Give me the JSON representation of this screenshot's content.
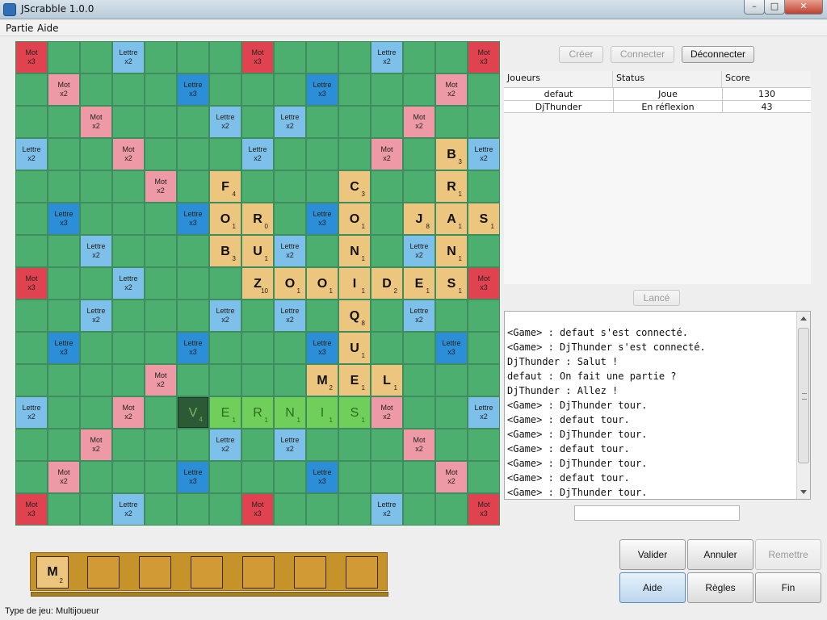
{
  "window": {
    "title": "JScrabble 1.0.0",
    "minimize": "–",
    "maximize": "□",
    "close": "✕"
  },
  "menubar": {
    "items": [
      "Partie",
      "Aide"
    ]
  },
  "board": {
    "letters": {
      "A": 1,
      "B": 3,
      "C": 3,
      "D": 2,
      "E": 1,
      "F": 4,
      "I": 1,
      "J": 8,
      "L": 1,
      "M": 2,
      "N": 1,
      "O": 1,
      "Q": 8,
      "R": 1,
      "S": 1,
      "U": 1,
      "V": 4,
      "Z": 10
    },
    "premium_labels": {
      "tw": "Mot\nx3",
      "dw": "Mot\nx2",
      "tl": "Lettre\nx3",
      "dl": "Lettre\nx2"
    },
    "layout": [
      "T..d...T...d..T",
      ".D...t...t...D.",
      "..D...d.d...D..",
      "d..D...d...D..d",
      "....D.....D....",
      ".t...t...t...t.",
      "..d...d.d...d..",
      "T..d.......d..T",
      "..d...d.d...d..",
      ".t...t...t...t.",
      "....D.....D....",
      "d..D.......D..d",
      "..D...d.d...D..",
      ".D...t...t...D.",
      "T..d...T...d..T"
    ],
    "tiles": [
      {
        "row": 3,
        "col": 13,
        "letter": "B",
        "state": "placed"
      },
      {
        "row": 4,
        "col": 6,
        "letter": "F",
        "state": "placed"
      },
      {
        "row": 4,
        "col": 10,
        "letter": "C",
        "state": "placed"
      },
      {
        "row": 4,
        "col": 13,
        "letter": "R",
        "state": "placed"
      },
      {
        "row": 5,
        "col": 6,
        "letter": "O",
        "state": "placed"
      },
      {
        "row": 5,
        "col": 7,
        "letter": "R",
        "state": "placed",
        "value": 0
      },
      {
        "row": 5,
        "col": 10,
        "letter": "O",
        "state": "placed"
      },
      {
        "row": 5,
        "col": 12,
        "letter": "J",
        "state": "placed"
      },
      {
        "row": 5,
        "col": 13,
        "letter": "A",
        "state": "placed"
      },
      {
        "row": 5,
        "col": 14,
        "letter": "S",
        "state": "placed"
      },
      {
        "row": 6,
        "col": 6,
        "letter": "B",
        "state": "placed"
      },
      {
        "row": 6,
        "col": 7,
        "letter": "U",
        "state": "placed"
      },
      {
        "row": 6,
        "col": 10,
        "letter": "N",
        "state": "placed"
      },
      {
        "row": 6,
        "col": 13,
        "letter": "N",
        "state": "placed"
      },
      {
        "row": 7,
        "col": 7,
        "letter": "Z",
        "state": "placed"
      },
      {
        "row": 7,
        "col": 8,
        "letter": "O",
        "state": "placed"
      },
      {
        "row": 7,
        "col": 9,
        "letter": "O",
        "state": "placed"
      },
      {
        "row": 7,
        "col": 10,
        "letter": "I",
        "state": "placed"
      },
      {
        "row": 7,
        "col": 11,
        "letter": "D",
        "state": "placed"
      },
      {
        "row": 7,
        "col": 12,
        "letter": "E",
        "state": "placed"
      },
      {
        "row": 7,
        "col": 13,
        "letter": "S",
        "state": "placed"
      },
      {
        "row": 8,
        "col": 10,
        "letter": "Q",
        "state": "placed"
      },
      {
        "row": 9,
        "col": 10,
        "letter": "U",
        "state": "placed"
      },
      {
        "row": 10,
        "col": 9,
        "letter": "M",
        "state": "placed"
      },
      {
        "row": 10,
        "col": 10,
        "letter": "E",
        "state": "placed"
      },
      {
        "row": 10,
        "col": 11,
        "letter": "L",
        "state": "placed"
      },
      {
        "row": 11,
        "col": 5,
        "letter": "V",
        "state": "selected"
      },
      {
        "row": 11,
        "col": 6,
        "letter": "E",
        "state": "current"
      },
      {
        "row": 11,
        "col": 7,
        "letter": "R",
        "state": "current"
      },
      {
        "row": 11,
        "col": 8,
        "letter": "N",
        "state": "current"
      },
      {
        "row": 11,
        "col": 9,
        "letter": "I",
        "state": "current"
      },
      {
        "row": 11,
        "col": 10,
        "letter": "S",
        "state": "current"
      }
    ]
  },
  "rack": {
    "tiles": [
      {
        "letter": "M",
        "value": 2
      },
      null,
      null,
      null,
      null,
      null,
      null
    ]
  },
  "connection": {
    "create": "Créer",
    "connect": "Connecter",
    "disconnect": "Déconnecter"
  },
  "players": {
    "columns": [
      "Joueurs",
      "Status",
      "Score"
    ],
    "rows": [
      [
        "defaut",
        "Joue",
        "130"
      ],
      [
        "DjThunder",
        "En réflexion",
        "43"
      ]
    ]
  },
  "launch_label": "Lancé",
  "chat": {
    "lines": [
      "<Game> : defaut s'est connecté.",
      "<Game> : DjThunder s'est connecté.",
      "DjThunder : Salut !",
      "defaut : On fait une partie ?",
      "DjThunder : Allez !",
      "<Game> : DjThunder tour.",
      "<Game> : defaut tour.",
      "<Game> : DjThunder tour.",
      "<Game> : defaut tour.",
      "<Game> : DjThunder tour.",
      "<Game> : defaut tour.",
      "<Game> : DjThunder tour."
    ],
    "input_value": ""
  },
  "actions": {
    "validate": "Valider",
    "cancel": "Annuler",
    "reset": "Remettre",
    "help": "Aide",
    "rules": "Règles",
    "end": "Fin"
  },
  "status_bar": "Type de jeu: Multijoueur"
}
